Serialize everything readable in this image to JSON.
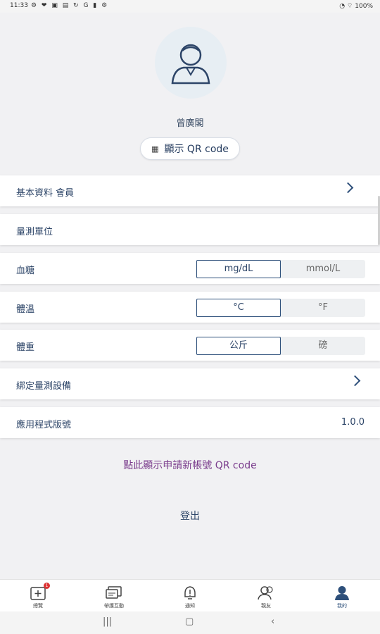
{
  "status_bar": {
    "time": "11:33",
    "battery": "100%"
  },
  "profile": {
    "name": "曾廣閣",
    "qr_button_label": "顯示 QR code"
  },
  "rows": {
    "basic_info": {
      "label": "基本資料  會員"
    },
    "units_header": {
      "label": "量測單位"
    },
    "blood_sugar": {
      "label": "血糖",
      "selected": "mg/dL",
      "other": "mmol/L"
    },
    "temperature": {
      "label": "體溫",
      "selected": "°C",
      "other": "°F"
    },
    "weight": {
      "label": "體重",
      "selected": "公斤",
      "other": "磅"
    },
    "bind_device": {
      "label": "綁定量測設備"
    },
    "app_version": {
      "label": "應用程式版號",
      "value": "1.0.0"
    }
  },
  "links": {
    "apply_qr": "點此顯示申請新帳號 QR code",
    "logout": "登出"
  },
  "tabs": [
    {
      "label": "總覽",
      "icon": "add-record-icon",
      "badge": "1"
    },
    {
      "label": "帶護互動",
      "icon": "chat-icon"
    },
    {
      "label": "通知",
      "icon": "alert-icon"
    },
    {
      "label": "親友",
      "icon": "contacts-icon"
    },
    {
      "label": "我的",
      "icon": "profile-icon",
      "active": true
    }
  ],
  "colors": {
    "accent": "#2d4f7a",
    "link_purple": "#7a3c8c"
  }
}
